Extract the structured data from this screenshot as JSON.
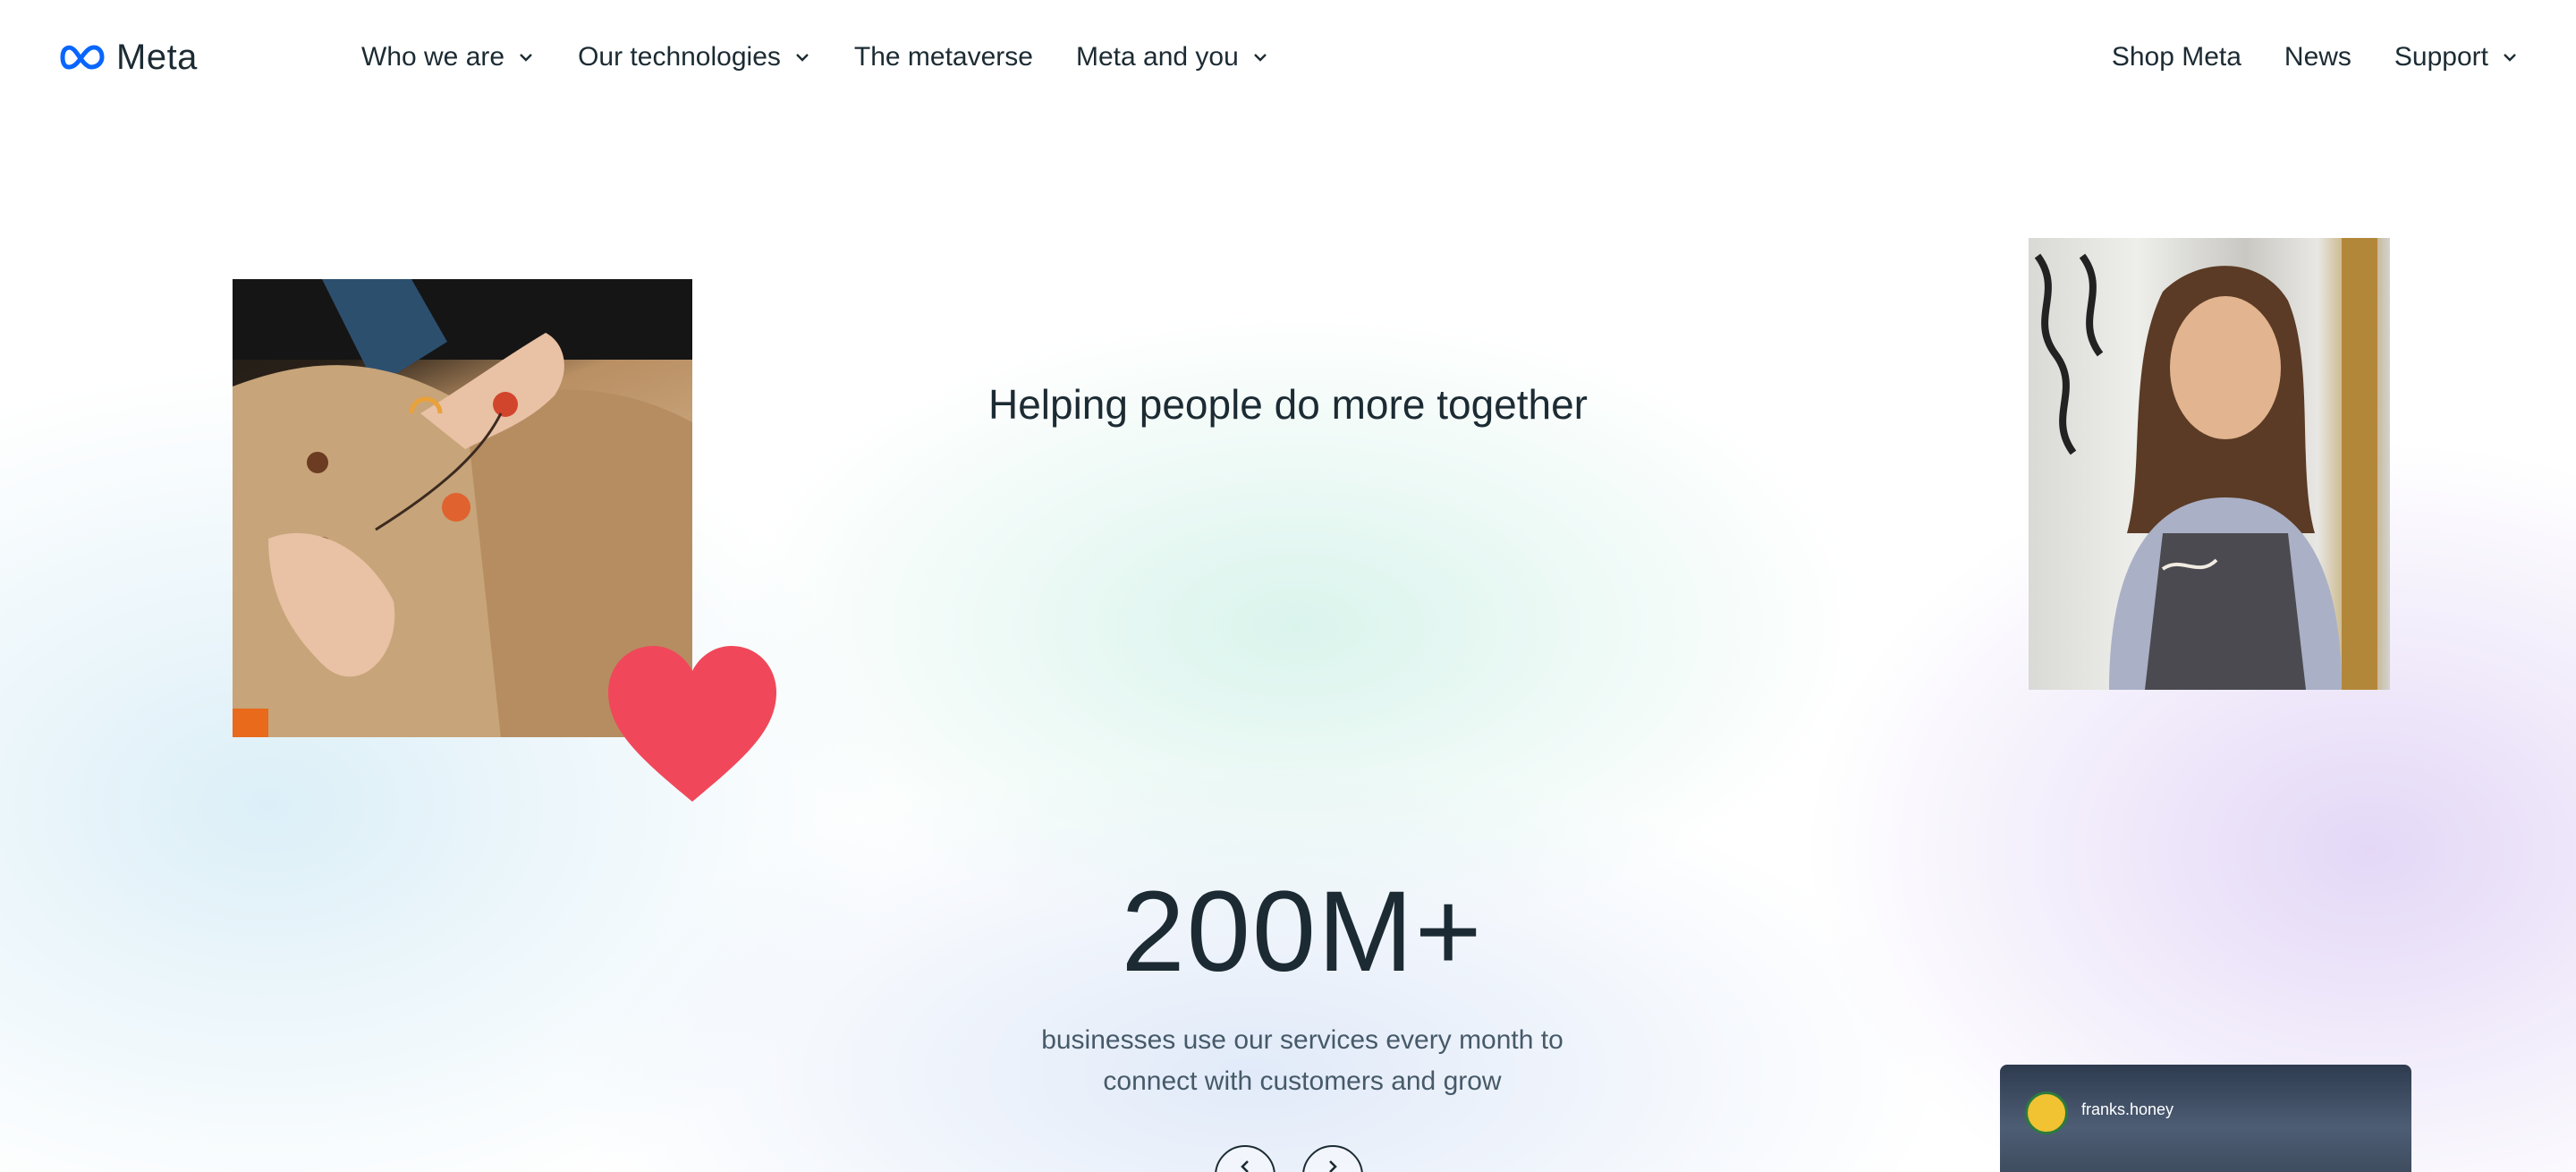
{
  "brand": {
    "name": "Meta",
    "logo_icon": "meta-infinity-logo",
    "color": "#0866ff"
  },
  "nav": {
    "left": [
      {
        "label": "Who we are",
        "dropdown": true
      },
      {
        "label": "Our technologies",
        "dropdown": true
      },
      {
        "label": "The metaverse",
        "dropdown": false
      },
      {
        "label": "Meta and you",
        "dropdown": true
      }
    ],
    "right": [
      {
        "label": "Shop Meta",
        "dropdown": false
      },
      {
        "label": "News",
        "dropdown": false
      },
      {
        "label": "Support",
        "dropdown": true
      }
    ]
  },
  "hero": {
    "headline": "Helping people do more together",
    "heart_color": "#f0485a"
  },
  "stat": {
    "value": "200M+",
    "caption_line1": "businesses use our services every month to",
    "caption_line2": "connect with customers and grow"
  },
  "carousel": {
    "prev_icon": "chevron-left-icon",
    "next_icon": "chevron-right-icon"
  },
  "social_card": {
    "handle": "franks.honey"
  }
}
